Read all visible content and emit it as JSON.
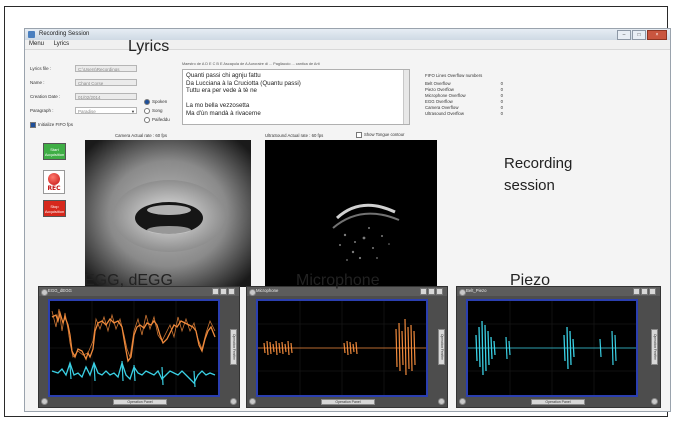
{
  "window": {
    "title": "Recording Session"
  },
  "menu": [
    {
      "label": "Menu"
    },
    {
      "label": "Lyrics"
    }
  ],
  "overlays": {
    "lyrics": "Lyrics",
    "recording_line1": "Recording",
    "recording_line2": "session",
    "egg": "EGG, dEGG",
    "microphone": "Microphone",
    "piezo": "Piezo"
  },
  "form": {
    "lyrics_file_label": "Lyrics file :",
    "lyrics_file_value": "C:\\Users\\Recordings",
    "name_label": "Name :",
    "name_value": "Chant Corse",
    "date_label": "Creation Date :",
    "date_value": "01/02/2014",
    "paragraph_label": "Paragraph :",
    "paragraph_value": "Paradise",
    "radio_options": [
      {
        "label": "Spoken",
        "selected": true
      },
      {
        "label": "Song",
        "selected": false
      },
      {
        "label": "Paifeddu",
        "selected": false
      }
    ],
    "initialize_label": "Initialize FIFO fps"
  },
  "lyrics_box": {
    "header": "Maestro de A   D   E   C   B   E  Ascapula de A  Auroraire di ... Pagliaccio ... cantica de Arti",
    "lines": [
      "Quanti passi chi agnju fattu",
      "Da Lucciana à la Cruciotta (Quantu passi)",
      "Tuttu era per vede à tè ne",
      "",
      "La mo bella vezzosetta",
      "Ma d'ùn mandà à rivacerne"
    ]
  },
  "fifo": {
    "title": "FIFO Lines Overflow numbers",
    "rows": [
      {
        "label": "Belt Overflow",
        "value": "0"
      },
      {
        "label": "Piezo Overflow",
        "value": "0"
      },
      {
        "label": "Microphone Overflow",
        "value": "0"
      },
      {
        "label": "EGG Overflow",
        "value": "0"
      },
      {
        "label": "Camera Overflow",
        "value": "0"
      },
      {
        "label": "Ultrasound Overflow",
        "value": "0"
      }
    ]
  },
  "camera": {
    "label": "Camera Actual rate : 60 fps"
  },
  "ultrasound": {
    "label": "UltraSound Actual rate : 60 fps",
    "checkbox_label": "Show Tongue contour"
  },
  "buttons": {
    "start": "Start Acquisition",
    "rec": "REC",
    "stop": "Stop Acquisition"
  },
  "panels": [
    {
      "title": "EGG_dEGG",
      "side_label": "Operation Fenêtre",
      "ctrl_label": "Operation Panel"
    },
    {
      "title": "Microphone",
      "side_label": "Operation Fenêtre",
      "ctrl_label": "Operation Panel"
    },
    {
      "title": "Belt_Piezo",
      "side_label": "Operation Fenêtre",
      "ctrl_label": "Operation Panel"
    }
  ],
  "colors": {
    "egg_trace": "#f08a3c",
    "degg_trace": "#3ad0e4",
    "mic_trace": "#f08a3c",
    "piezo_trace": "#3ad0e4",
    "plot_border": "#2b3fb0",
    "start_button": "#3fae45",
    "stop_button": "#d6281c"
  }
}
